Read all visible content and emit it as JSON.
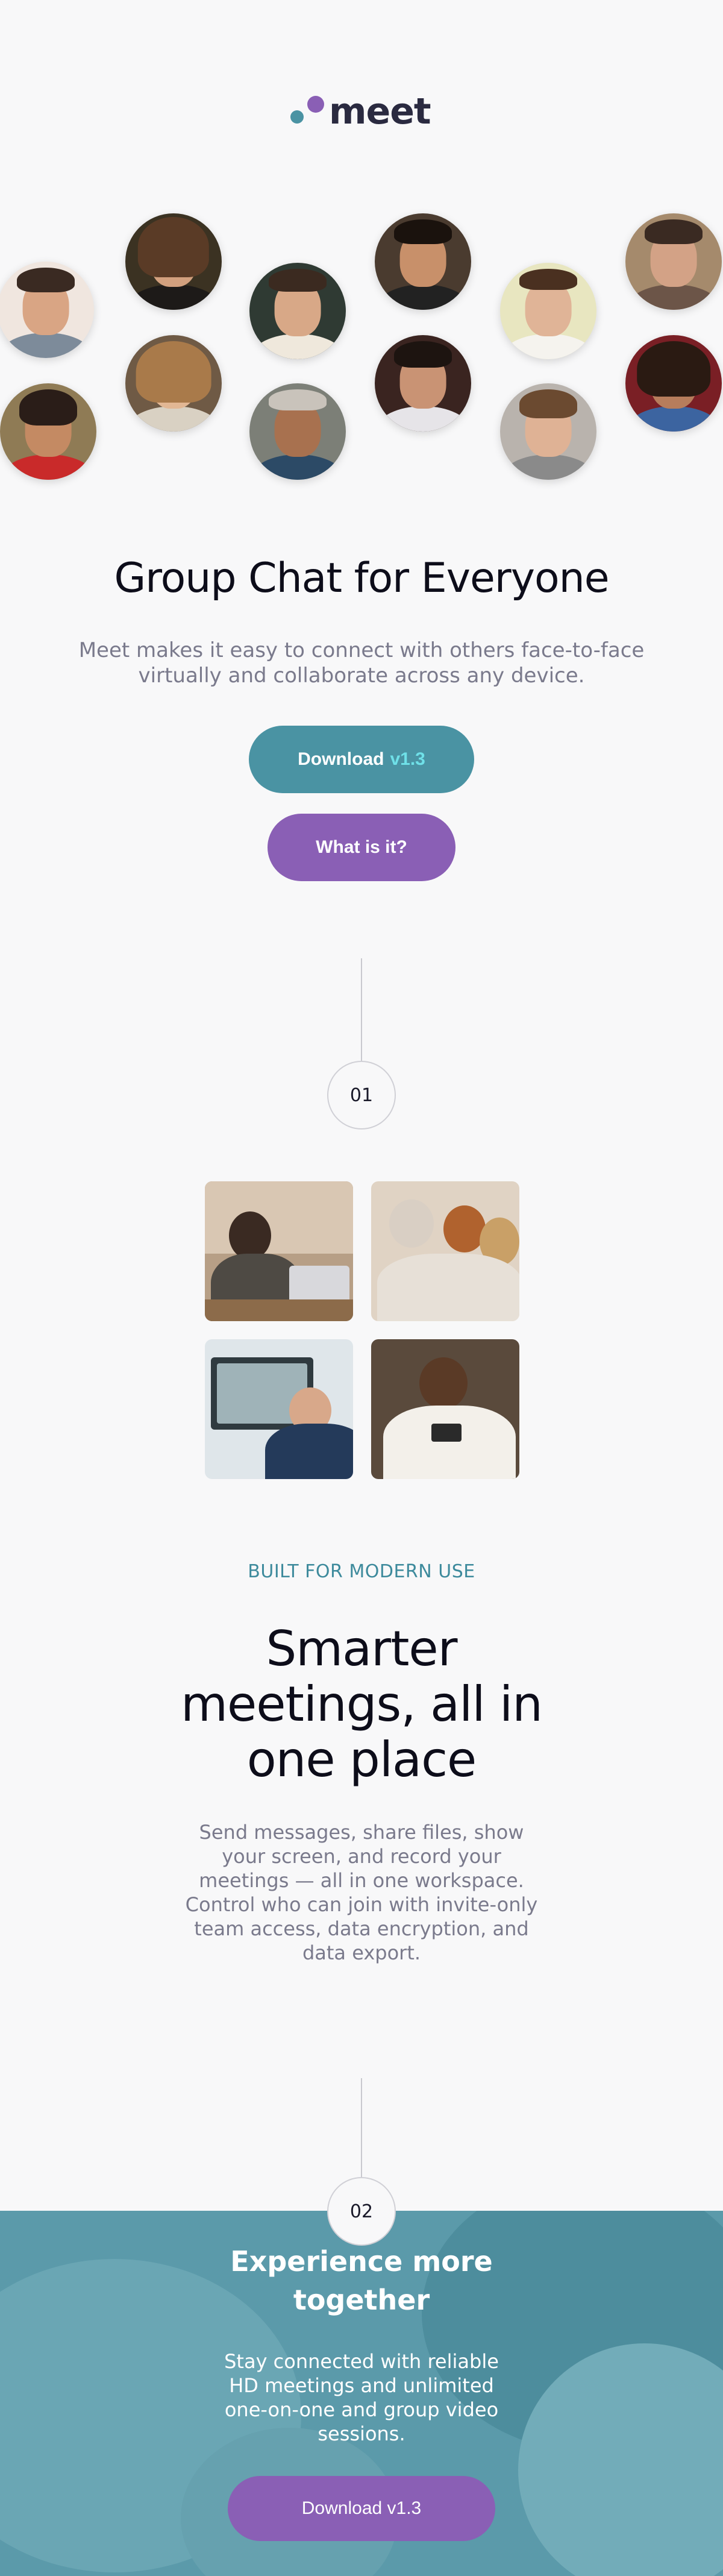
{
  "brand": {
    "name": "meet",
    "colors": {
      "teal": "#4a93a3",
      "purple": "#8a5fb5",
      "ink": "#0d0d1a",
      "muted": "#7a7a8c",
      "accent": "#6fe0e8"
    }
  },
  "hero": {
    "title": "Group Chat for Everyone",
    "subtitle": "Meet makes it easy to connect with others face-to-face virtually and collaborate across any device.",
    "download_label": "Download",
    "download_version": "v1.3",
    "what_label": "What is it?"
  },
  "avatars": [
    {
      "name": "avatar-1"
    },
    {
      "name": "avatar-2"
    },
    {
      "name": "avatar-3"
    },
    {
      "name": "avatar-4"
    },
    {
      "name": "avatar-5"
    },
    {
      "name": "avatar-6"
    },
    {
      "name": "avatar-7"
    },
    {
      "name": "avatar-8"
    },
    {
      "name": "avatar-9"
    },
    {
      "name": "avatar-10"
    },
    {
      "name": "avatar-11"
    },
    {
      "name": "avatar-12"
    }
  ],
  "step1": {
    "number": "01",
    "eyebrow": "BUILT FOR MODERN USE",
    "title": "Smarter meetings, all in one place",
    "body": "Send messages, share files, show your screen, and record your meetings — all in one workspace. Control who can join with invite-only team access, data encryption, and data export."
  },
  "step2": {
    "number": "02",
    "title": "Experience more together",
    "body": "Stay connected with reliable HD meetings and unlimited one-on-one and group video sessions.",
    "download_label": "Download v1.3"
  }
}
